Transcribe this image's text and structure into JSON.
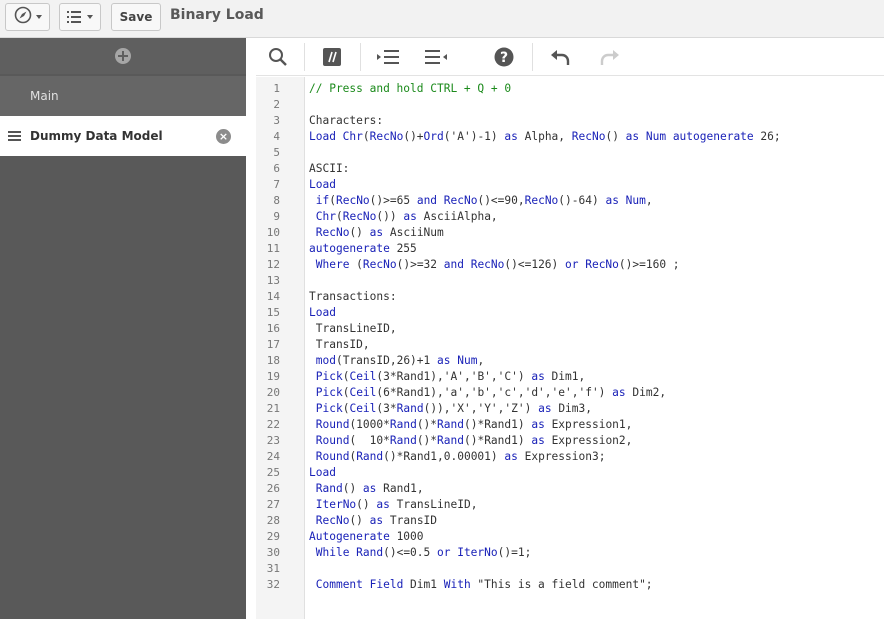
{
  "topbar": {
    "nav_icon": "compass-icon",
    "list_icon": "list-icon",
    "save_label": "Save",
    "app_title": "Binary Load"
  },
  "sidebar": {
    "add_icon": "plus-circle-icon",
    "items": [
      {
        "label": "Main"
      },
      {
        "label": "Dummy Data Model"
      }
    ]
  },
  "toolbar": {
    "icons": [
      "search-icon",
      "comment-icon",
      "indent-icon",
      "outdent-icon",
      "help-icon",
      "undo-icon",
      "redo-icon"
    ]
  },
  "editor": {
    "lines": [
      [
        [
          "c",
          "// Press and hold CTRL + Q + 0"
        ]
      ],
      [],
      [
        [
          "s",
          "Characters:"
        ]
      ],
      [
        [
          "k",
          "Load Chr"
        ],
        [
          "s",
          "("
        ],
        [
          "k",
          "RecNo"
        ],
        [
          "s",
          "()+"
        ],
        [
          "k",
          "Ord"
        ],
        [
          "s",
          "('A')-1) "
        ],
        [
          "k",
          "as"
        ],
        [
          "s",
          " Alpha, "
        ],
        [
          "k",
          "RecNo"
        ],
        [
          "s",
          "() "
        ],
        [
          "k",
          "as Num autogenerate"
        ],
        [
          "s",
          " 26;"
        ]
      ],
      [],
      [
        [
          "s",
          "ASCII:"
        ]
      ],
      [
        [
          "k",
          "Load"
        ]
      ],
      [
        [
          "s",
          " "
        ],
        [
          "k",
          "if"
        ],
        [
          "s",
          "("
        ],
        [
          "k",
          "RecNo"
        ],
        [
          "s",
          "()>=65 "
        ],
        [
          "k",
          "and RecNo"
        ],
        [
          "s",
          "()<=90,"
        ],
        [
          "k",
          "RecNo"
        ],
        [
          "s",
          "()-64) "
        ],
        [
          "k",
          "as Num"
        ],
        [
          "s",
          ","
        ]
      ],
      [
        [
          "s",
          " "
        ],
        [
          "k",
          "Chr"
        ],
        [
          "s",
          "("
        ],
        [
          "k",
          "RecNo"
        ],
        [
          "s",
          "()) "
        ],
        [
          "k",
          "as"
        ],
        [
          "s",
          " AsciiAlpha,"
        ]
      ],
      [
        [
          "s",
          " "
        ],
        [
          "k",
          "RecNo"
        ],
        [
          "s",
          "() "
        ],
        [
          "k",
          "as"
        ],
        [
          "s",
          " AsciiNum"
        ]
      ],
      [
        [
          "k",
          "autogenerate"
        ],
        [
          "s",
          " 255"
        ]
      ],
      [
        [
          "s",
          " "
        ],
        [
          "k",
          "Where"
        ],
        [
          "s",
          " ("
        ],
        [
          "k",
          "RecNo"
        ],
        [
          "s",
          "()>=32 "
        ],
        [
          "k",
          "and RecNo"
        ],
        [
          "s",
          "()<=126) "
        ],
        [
          "k",
          "or RecNo"
        ],
        [
          "s",
          "()>=160 ;"
        ]
      ],
      [],
      [
        [
          "s",
          "Transactions:"
        ]
      ],
      [
        [
          "k",
          "Load"
        ]
      ],
      [
        [
          "s",
          " TransLineID,"
        ]
      ],
      [
        [
          "s",
          " TransID,"
        ]
      ],
      [
        [
          "s",
          " "
        ],
        [
          "k",
          "mod"
        ],
        [
          "s",
          "(TransID,26)+1 "
        ],
        [
          "k",
          "as Num"
        ],
        [
          "s",
          ","
        ]
      ],
      [
        [
          "s",
          " "
        ],
        [
          "k",
          "Pick"
        ],
        [
          "s",
          "("
        ],
        [
          "k",
          "Ceil"
        ],
        [
          "s",
          "(3*Rand1),'A','B','C') "
        ],
        [
          "k",
          "as"
        ],
        [
          "s",
          " Dim1,"
        ]
      ],
      [
        [
          "s",
          " "
        ],
        [
          "k",
          "Pick"
        ],
        [
          "s",
          "("
        ],
        [
          "k",
          "Ceil"
        ],
        [
          "s",
          "(6*Rand1),'a','b','c','d','e','f') "
        ],
        [
          "k",
          "as"
        ],
        [
          "s",
          " Dim2,"
        ]
      ],
      [
        [
          "s",
          " "
        ],
        [
          "k",
          "Pick"
        ],
        [
          "s",
          "("
        ],
        [
          "k",
          "Ceil"
        ],
        [
          "s",
          "(3*"
        ],
        [
          "k",
          "Rand"
        ],
        [
          "s",
          "()),'X','Y','Z') "
        ],
        [
          "k",
          "as"
        ],
        [
          "s",
          " Dim3,"
        ]
      ],
      [
        [
          "s",
          " "
        ],
        [
          "k",
          "Round"
        ],
        [
          "s",
          "(1000*"
        ],
        [
          "k",
          "Rand"
        ],
        [
          "s",
          "()*"
        ],
        [
          "k",
          "Rand"
        ],
        [
          "s",
          "()*Rand1) "
        ],
        [
          "k",
          "as"
        ],
        [
          "s",
          " Expression1,"
        ]
      ],
      [
        [
          "s",
          " "
        ],
        [
          "k",
          "Round"
        ],
        [
          "s",
          "(  10*"
        ],
        [
          "k",
          "Rand"
        ],
        [
          "s",
          "()*"
        ],
        [
          "k",
          "Rand"
        ],
        [
          "s",
          "()*Rand1) "
        ],
        [
          "k",
          "as"
        ],
        [
          "s",
          " Expression2,"
        ]
      ],
      [
        [
          "s",
          " "
        ],
        [
          "k",
          "Round"
        ],
        [
          "s",
          "("
        ],
        [
          "k",
          "Rand"
        ],
        [
          "s",
          "()*Rand1,0.00001) "
        ],
        [
          "k",
          "as"
        ],
        [
          "s",
          " Expression3;"
        ]
      ],
      [
        [
          "k",
          "Load"
        ]
      ],
      [
        [
          "s",
          " "
        ],
        [
          "k",
          "Rand"
        ],
        [
          "s",
          "() "
        ],
        [
          "k",
          "as"
        ],
        [
          "s",
          " Rand1,"
        ]
      ],
      [
        [
          "s",
          " "
        ],
        [
          "k",
          "IterNo"
        ],
        [
          "s",
          "() "
        ],
        [
          "k",
          "as"
        ],
        [
          "s",
          " TransLineID,"
        ]
      ],
      [
        [
          "s",
          " "
        ],
        [
          "k",
          "RecNo"
        ],
        [
          "s",
          "() "
        ],
        [
          "k",
          "as"
        ],
        [
          "s",
          " TransID"
        ]
      ],
      [
        [
          "k",
          "Autogenerate"
        ],
        [
          "s",
          " 1000"
        ]
      ],
      [
        [
          "s",
          " "
        ],
        [
          "k",
          "While Rand"
        ],
        [
          "s",
          "()<=0.5 "
        ],
        [
          "k",
          "or IterNo"
        ],
        [
          "s",
          "()=1;"
        ]
      ],
      [],
      [
        [
          "s",
          " "
        ],
        [
          "k",
          "Comment Field"
        ],
        [
          "s",
          " Dim1 "
        ],
        [
          "k",
          "With"
        ],
        [
          "s",
          " \"This is a field comment\";"
        ]
      ]
    ]
  }
}
